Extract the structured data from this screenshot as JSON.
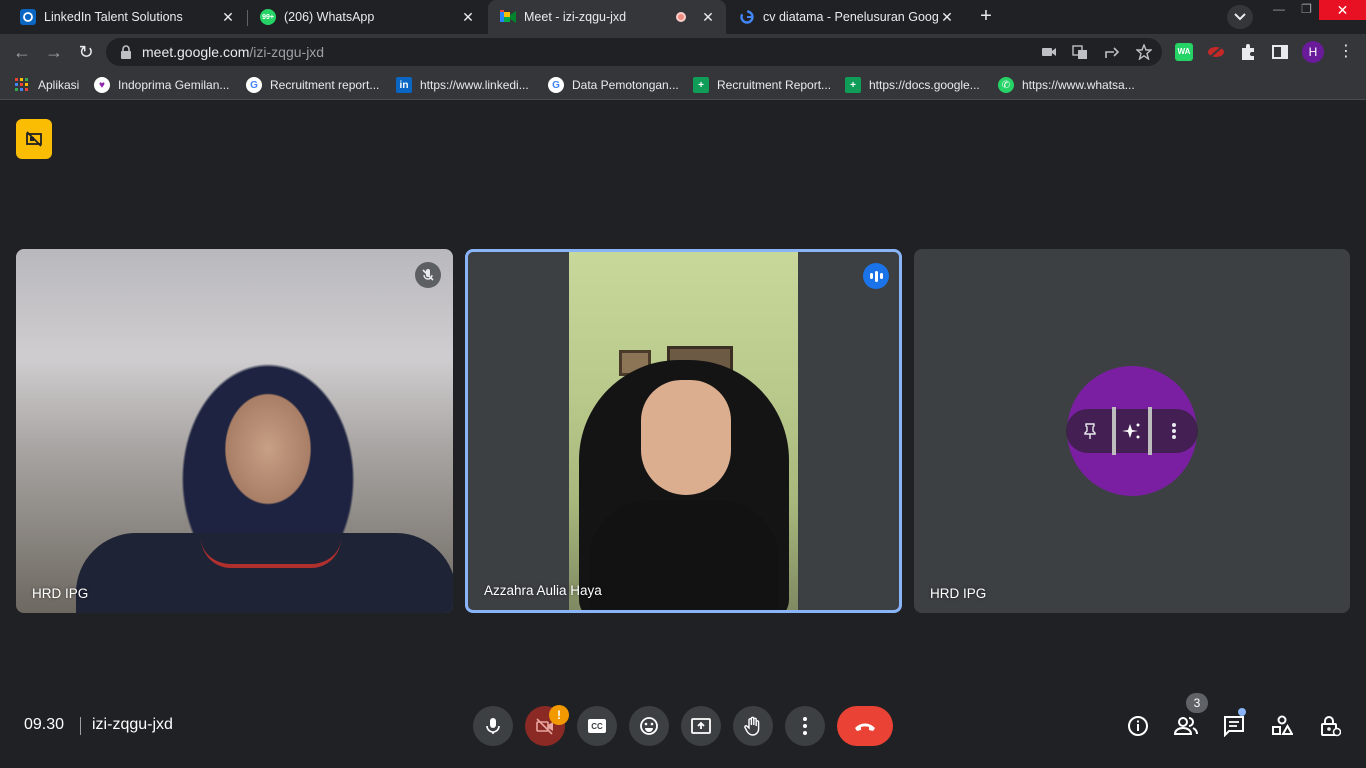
{
  "browser": {
    "tabs": [
      {
        "title": "LinkedIn Talent Solutions",
        "icon": "linkedin-talent-icon"
      },
      {
        "title": "(206) WhatsApp",
        "icon": "whatsapp-icon",
        "badge": "99+"
      },
      {
        "title": "Meet - izi-zqgu-jxd",
        "icon": "google-meet-icon",
        "recording": true
      },
      {
        "title": "cv diatama - Penelusuran Google",
        "icon": "google-icon"
      }
    ],
    "url": {
      "host": "meet.google.com",
      "path": "/izi-zqgu-jxd"
    },
    "profile_initial": "H",
    "extension_wa_label": "WA",
    "bookmarks": [
      {
        "label": "Aplikasi",
        "icon": "apps-grid-icon"
      },
      {
        "label": "Indoprima Gemilan...",
        "icon": "heart-logo-icon"
      },
      {
        "label": "Recruitment report...",
        "icon": "google-icon"
      },
      {
        "label": "https://www.linkedi...",
        "icon": "linkedin-icon"
      },
      {
        "label": "Data Pemotongan...",
        "icon": "google-icon"
      },
      {
        "label": "Recruitment Report...",
        "icon": "google-sheets-icon"
      },
      {
        "label": "https://docs.google...",
        "icon": "google-sheets-icon"
      },
      {
        "label": "https://www.whatsa...",
        "icon": "whatsapp-icon"
      }
    ]
  },
  "meet": {
    "participants": [
      {
        "name": "HRD IPG",
        "muted": true
      },
      {
        "name": "Azzahra Aulia Haya",
        "speaking": true
      },
      {
        "name": "HRD IPG",
        "video_off": true
      }
    ],
    "time": "09.30",
    "meeting_code": "izi-zqgu-jxd",
    "camera_warning": "!",
    "people_count": "3"
  },
  "colors": {
    "accent_blue": "#8ab4f8",
    "end_call_red": "#ea4335",
    "avatar_purple": "#7b1fa2",
    "warning_yellow": "#fbbc04"
  }
}
